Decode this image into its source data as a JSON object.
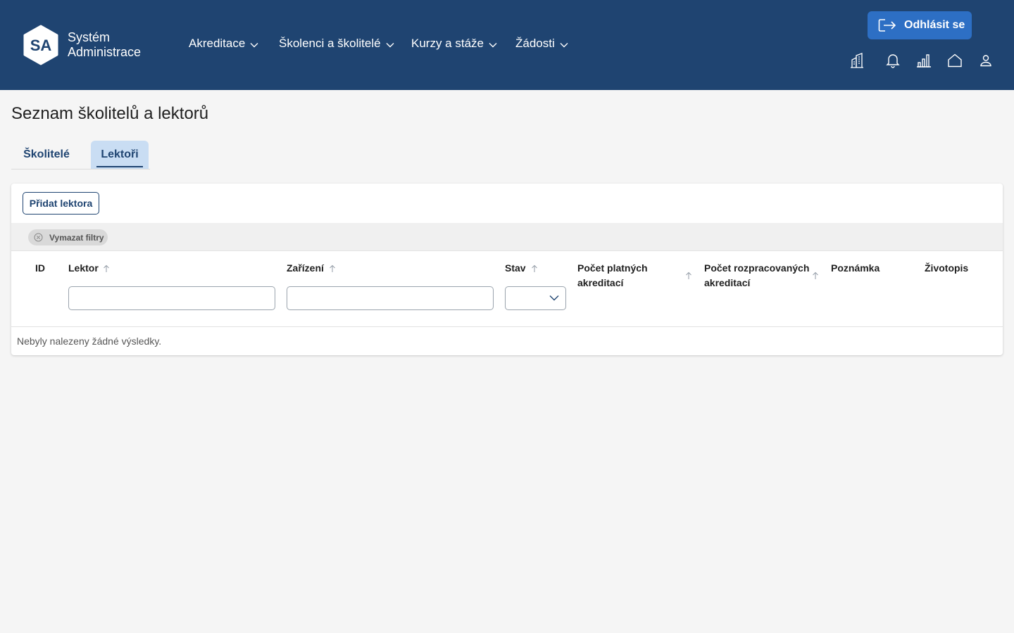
{
  "app": {
    "logo_initials": "SA",
    "logo_line1": "Systém",
    "logo_line2": "Administrace"
  },
  "nav": {
    "items": [
      {
        "label": "Akreditace"
      },
      {
        "label": "Školenci a školitelé"
      },
      {
        "label": "Kurzy a stáže"
      },
      {
        "label": "Žádosti"
      }
    ]
  },
  "header": {
    "logout_label": "Odhlásit se",
    "icons": [
      "building-icon",
      "bell-icon",
      "bar-chart-icon",
      "home-icon",
      "user-icon"
    ]
  },
  "page": {
    "title": "Seznam školitelů a lektorů",
    "tabs": [
      {
        "label": "Školitelé",
        "active": false
      },
      {
        "label": "Lektoři",
        "active": true
      }
    ]
  },
  "table": {
    "add_button": "Přidat lektora",
    "clear_filters": "Vymazat filtry",
    "columns": [
      {
        "label": "ID"
      },
      {
        "label": "Lektor"
      },
      {
        "label": "Zařízení"
      },
      {
        "label": "Stav"
      },
      {
        "label_line1": "Počet platných",
        "label_line2": "akreditací"
      },
      {
        "label_line1": "Počet rozpracovaných",
        "label_line2": "akreditací"
      },
      {
        "label": "Poznámka"
      },
      {
        "label": "Životopis"
      }
    ],
    "filters": {
      "lektor_value": "",
      "zarizeni_value": "",
      "stav_value": ""
    },
    "empty_message": "Nebyly nalezeny žádné výsledky."
  },
  "colors": {
    "header_bg": "#1f4471",
    "primary_button": "#2d6fc4",
    "tab_active_bg": "#c9ddf3",
    "page_bg": "#f5f5f5"
  }
}
